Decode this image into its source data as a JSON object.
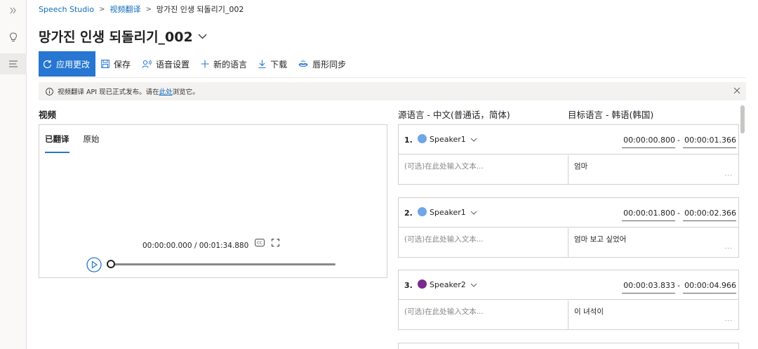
{
  "breadcrumb": {
    "root": "Speech Studio",
    "parent": "视频翻译",
    "current": "망가진 인생 되돌리기_002"
  },
  "page": {
    "title": "망가진 인생 되돌리기_002"
  },
  "toolbar": {
    "apply": "应用更改",
    "save": "保存",
    "voice_settings": "语音设置",
    "new_language": "新的语言",
    "download": "下载",
    "lip_sync": "唇形同步"
  },
  "notice": {
    "text": "视频翻译 API 现已正式发布。请在 ",
    "link": "此处",
    "suffix": "浏览它。"
  },
  "video": {
    "section_label": "视频",
    "tabs": [
      "已翻译",
      "原始"
    ],
    "time": "00:00:00.000 / 00:01:34.880"
  },
  "columns": {
    "source": "源语言 - 中文(普通话，简体)",
    "target": "目标语言 - 韩语(韩国)"
  },
  "segments": [
    {
      "num": "1.",
      "speaker": "Speaker1",
      "color": "#6ea6e8",
      "start": "00:00:00.800",
      "end": "00:00:01.366",
      "placeholder": "(可选)在此处输入文本...",
      "target": "엄마"
    },
    {
      "num": "2.",
      "speaker": "Speaker1",
      "color": "#6ea6e8",
      "start": "00:00:01.800",
      "end": "00:00:02.366",
      "placeholder": "(可选)在此处输入文本...",
      "target": "엄마 보고 싶었어"
    },
    {
      "num": "3.",
      "speaker": "Speaker2",
      "color": "#7a2a8f",
      "start": "00:00:03.833",
      "end": "00:00:04.966",
      "placeholder": "(可选)在此处输入文本...",
      "target": "이 녀석이"
    }
  ],
  "ellipsis": "...",
  "dash": "-",
  "icons": {
    "rail": [
      "expand-icon",
      "lightbulb-icon",
      "menu-icon"
    ],
    "accent": "#2676d2"
  }
}
